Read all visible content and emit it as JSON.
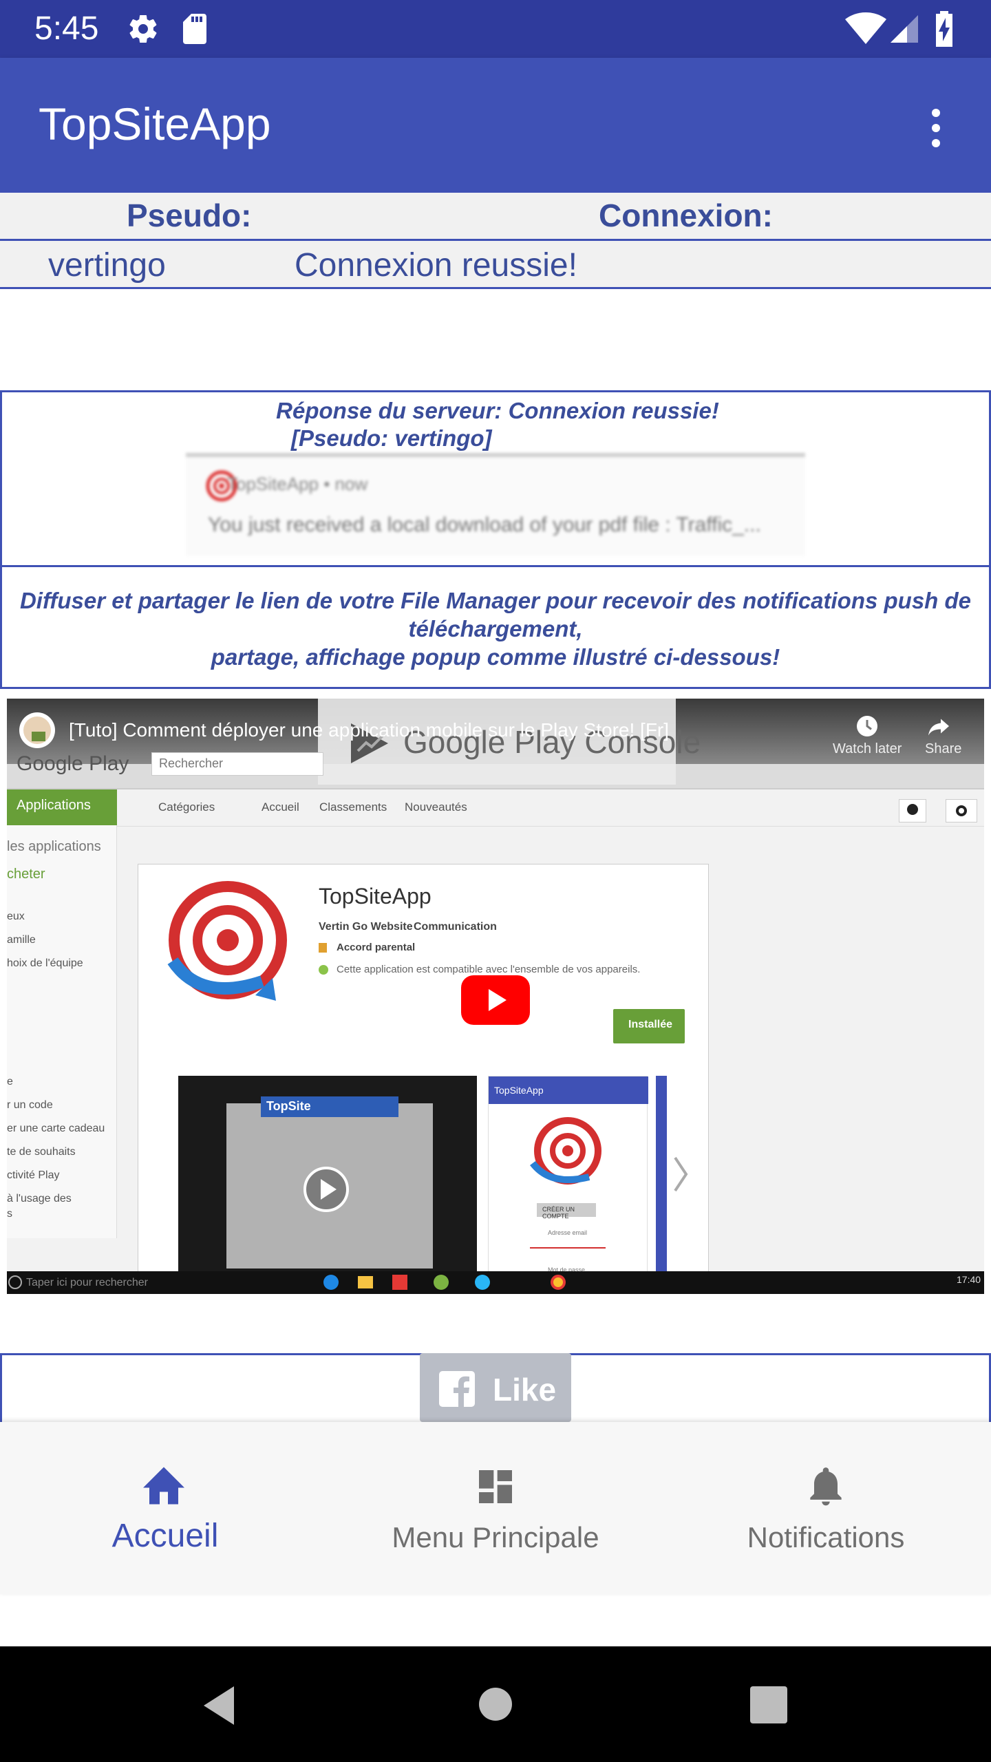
{
  "status_bar": {
    "time": "5:45",
    "icons": [
      "gear-icon",
      "sd-card-icon",
      "wifi-icon",
      "cell-signal-icon",
      "battery-charging-icon"
    ]
  },
  "app_bar": {
    "title": "TopSiteApp",
    "menu_icon": "more-vert-icon"
  },
  "table": {
    "headers": [
      "Pseudo:",
      "Connexion:"
    ],
    "row": [
      "vertingo",
      "Connexion reussie!"
    ]
  },
  "server_response": {
    "line1": "Réponse du serveur: Connexion reussie!",
    "line2": "[Pseudo: vertingo]"
  },
  "notification_preview": {
    "app_line": "TopSiteApp • now",
    "message": "You just received a local download of your pdf file : Traffic_..."
  },
  "share_info": {
    "line1": "Diffuser et partager le lien de votre File Manager pour recevoir des notifications push de",
    "line2": "téléchargement,",
    "line3": "partage, affichage popup comme illustré ci-dessous!"
  },
  "video": {
    "title": "[Tuto] Comment déployer une application mobile sur le Play Store! [Fr]",
    "watch_later": "Watch later",
    "share": "Share",
    "play_console": "Google Play Console",
    "store": {
      "logo": "Google Play",
      "search_placeholder": "Rechercher",
      "sidebar_active": "Applications",
      "sidebar_items": [
        "les applications",
        "cheter",
        "eux",
        "amille",
        "hoix de l'équipe",
        "e",
        "r un code",
        "er une carte cadeau",
        "te de souhaits",
        "ctivité Play",
        "à l'usage des",
        "s"
      ],
      "nav_tabs": [
        "Catégories",
        "Accueil",
        "Classements",
        "Nouveautés"
      ],
      "app_name": "TopSiteApp",
      "developer": "Vertin Go Website",
      "category": "Communication",
      "rating_label": "Accord parental",
      "compat_text": "Cette application est compatible avec l'ensemble de vos appareils.",
      "installed_button": "Installée",
      "screenshot_header": "TopSite",
      "phone_header": "TopSiteApp",
      "phone_button": "CRÉER UN COMPTE",
      "phone_field1": "Adresse email",
      "phone_field2": "Mot de passe"
    },
    "taskbar": {
      "search_placeholder": "Taper ici pour rechercher",
      "clock": "17:40"
    }
  },
  "like_button": {
    "label": "Like",
    "icon": "facebook-icon"
  },
  "bottom_nav": [
    {
      "label": "Accueil",
      "icon": "home-icon",
      "active": true
    },
    {
      "label": "Menu Principale",
      "icon": "dashboard-icon",
      "active": false
    },
    {
      "label": "Notifications",
      "icon": "bell-icon",
      "active": false
    }
  ],
  "colors": {
    "primary": "#3f51b5",
    "primary_dark": "#2f3b9c",
    "text_blue": "#3a4d9a",
    "play_green": "#689f38",
    "youtube_red": "#ff0000"
  }
}
